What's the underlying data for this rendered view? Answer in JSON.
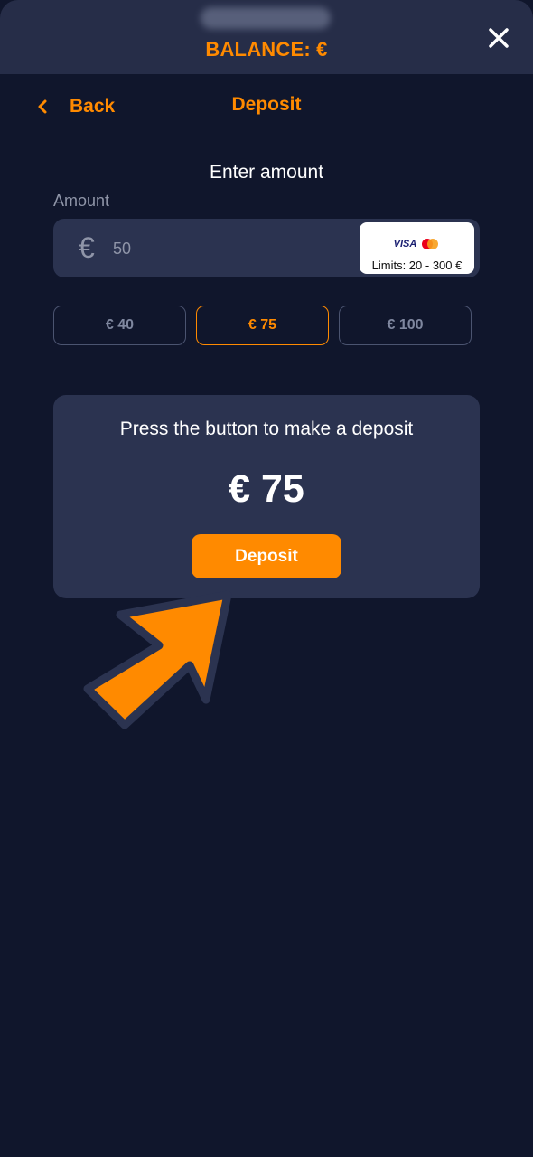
{
  "header": {
    "balance_label": "BALANCE: €"
  },
  "nav": {
    "back_label": "Back",
    "title": "Deposit"
  },
  "form": {
    "heading": "Enter amount",
    "amount_label": "Amount",
    "currency_symbol": "€",
    "amount_placeholder": "50",
    "limits_text": "Limits: 20 - 300 €",
    "card_brand_visa": "VISA"
  },
  "presets": [
    {
      "label": "€ 40",
      "selected": false
    },
    {
      "label": "€ 75",
      "selected": true
    },
    {
      "label": "€ 100",
      "selected": false
    }
  ],
  "confirm": {
    "text": "Press the button to make a deposit",
    "amount": "€ 75",
    "button_label": "Deposit"
  },
  "colors": {
    "accent": "#ff8a00",
    "background": "#10162c",
    "card": "#2b3350",
    "header": "#262d48"
  },
  "icons": {
    "close": "close-icon",
    "back": "chevron-left-icon",
    "pointer": "arrow-pointer-icon"
  }
}
